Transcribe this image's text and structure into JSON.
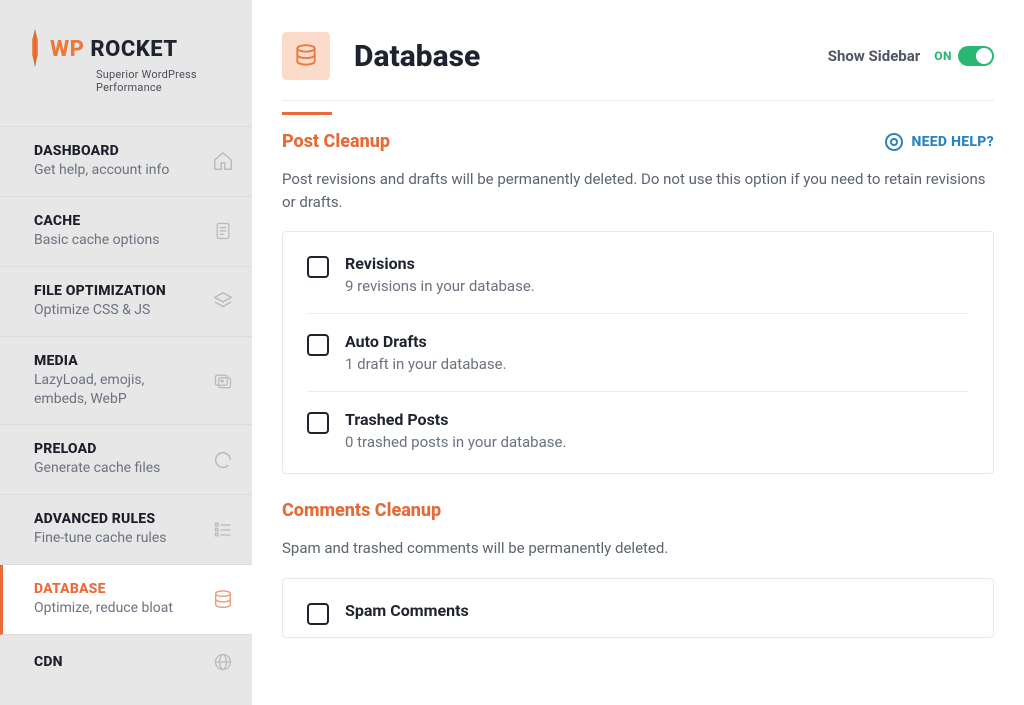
{
  "brand": {
    "wp": "WP",
    "rocket": " ROCKET",
    "tagline": "Superior WordPress Performance"
  },
  "sidebar": {
    "items": [
      {
        "title": "DASHBOARD",
        "sub": "Get help, account info",
        "icon": "home-icon",
        "active": false
      },
      {
        "title": "CACHE",
        "sub": "Basic cache options",
        "icon": "file-icon",
        "active": false
      },
      {
        "title": "FILE OPTIMIZATION",
        "sub": "Optimize CSS & JS",
        "icon": "layers-icon",
        "active": false
      },
      {
        "title": "MEDIA",
        "sub": "LazyLoad, emojis, embeds, WebP",
        "icon": "images-icon",
        "active": false
      },
      {
        "title": "PRELOAD",
        "sub": "Generate cache files",
        "icon": "refresh-icon",
        "active": false
      },
      {
        "title": "ADVANCED RULES",
        "sub": "Fine-tune cache rules",
        "icon": "list-icon",
        "active": false
      },
      {
        "title": "DATABASE",
        "sub": "Optimize, reduce bloat",
        "icon": "database-icon",
        "active": true
      },
      {
        "title": "CDN",
        "sub": "",
        "icon": "globe-icon",
        "active": false
      }
    ]
  },
  "header": {
    "title": "Database",
    "show_sidebar_label": "Show Sidebar",
    "toggle_state": "ON"
  },
  "help": {
    "label": "NEED HELP?"
  },
  "sections": {
    "post_cleanup": {
      "title": "Post Cleanup",
      "desc": "Post revisions and drafts will be permanently deleted. Do not use this option if you need to retain revisions or drafts.",
      "options": [
        {
          "title": "Revisions",
          "sub": "9 revisions in your database."
        },
        {
          "title": "Auto Drafts",
          "sub": "1 draft in your database."
        },
        {
          "title": "Trashed Posts",
          "sub": "0 trashed posts in your database."
        }
      ]
    },
    "comments_cleanup": {
      "title": "Comments Cleanup",
      "desc": "Spam and trashed comments will be permanently deleted.",
      "options": [
        {
          "title": "Spam Comments",
          "sub": ""
        }
      ]
    }
  }
}
